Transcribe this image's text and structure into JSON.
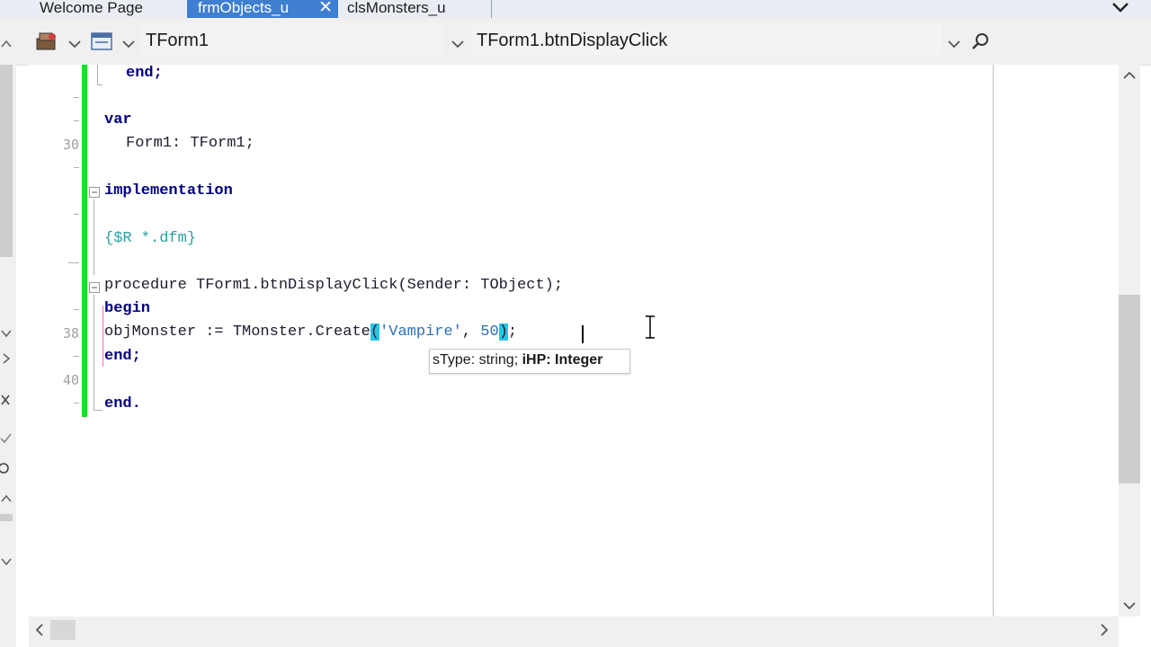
{
  "tabs": [
    {
      "label": "Welcome Page",
      "active": false
    },
    {
      "label": "frmObjects_u",
      "active": true,
      "close": "✕"
    },
    {
      "label": "clsMonsters_u",
      "active": false
    }
  ],
  "toolbar": {
    "class_combo": "TForm1",
    "method_combo": "TForm1.btnDisplayClick"
  },
  "line_numbers": [
    {
      "num": "30",
      "line": 30
    },
    {
      "num": "38",
      "line": 38
    },
    {
      "num": "40",
      "line": 40
    }
  ],
  "code": {
    "l1": "end;",
    "l2": "var",
    "l3": "Form1: TForm1;",
    "l4": "implementation",
    "l5": "{$R *.dfm}",
    "l6": "procedure TForm1.btnDisplayClick(Sender: TObject);",
    "l7": "begin",
    "l8a": "objMonster := TMonster.Create",
    "l8b": "(",
    "l8c": "'Vampire'",
    "l8d": ", ",
    "l8e": "50",
    "l8f": ")",
    "l8g": ";",
    "l9": "end;",
    "l10": "end."
  },
  "tooltip": {
    "param1": "sType: string; ",
    "param2": "iHP: Integer"
  },
  "colors": {
    "active_tab": "#3f7fd0",
    "modified_bar": "#22dd22",
    "bracket_highlight": "#26c6e6"
  }
}
